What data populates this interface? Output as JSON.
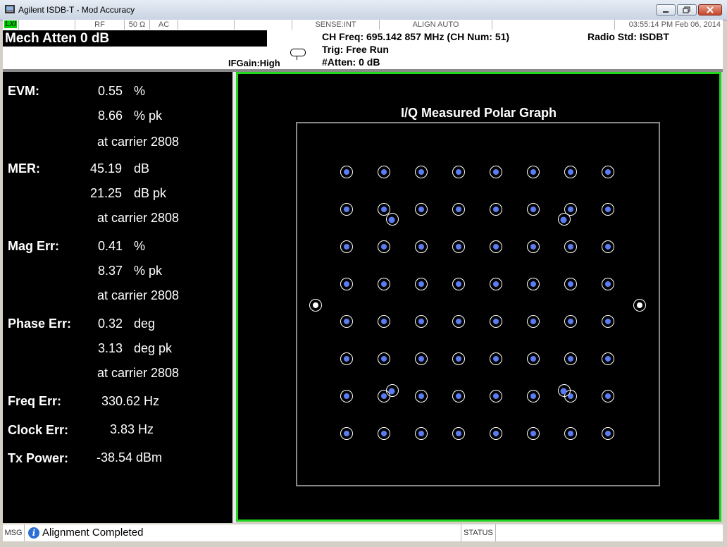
{
  "window": {
    "title": "Agilent ISDB-T - Mod Accuracy",
    "controls": {
      "minimize": "minimize",
      "restore": "restore",
      "close": "close"
    }
  },
  "status_bar": {
    "lxi": "LXI",
    "rf": "RF",
    "impedance": "50 Ω",
    "coupling": "AC",
    "sense": "SENSE:INT",
    "align": "ALIGN AUTO",
    "datetime": "03:55:14 PM Feb 06, 2014"
  },
  "header": {
    "mech_atten": "Mech Atten 0 dB",
    "ch_freq": "CH Freq: 695.142 857 MHz (CH Num: 51)",
    "trig": "Trig: Free Run",
    "atten": "#Atten: 0 dB",
    "ifgain": "IFGain:High",
    "radio_std": "Radio Std: ISDBT"
  },
  "metrics": {
    "evm": {
      "label": "EVM:",
      "rms_value": "0.55",
      "rms_unit": "%",
      "pk_value": "8.66",
      "pk_unit": "% pk",
      "carrier": "at carrier 2808"
    },
    "mer": {
      "label": "MER:",
      "rms_value": "45.19",
      "rms_unit": "dB",
      "pk_value": "21.25",
      "pk_unit": "dB pk",
      "carrier": "at carrier 2808"
    },
    "mag_err": {
      "label": "Mag Err:",
      "rms_value": "0.41",
      "rms_unit": "%",
      "pk_value": "8.37",
      "pk_unit": "% pk",
      "carrier": "at carrier 2808"
    },
    "phase_err": {
      "label": "Phase Err:",
      "rms_value": "0.32",
      "rms_unit": "deg",
      "pk_value": "3.13",
      "pk_unit": "deg pk",
      "carrier": "at carrier 2808"
    },
    "freq_err": {
      "label": "Freq Err:",
      "value": "330.62 Hz"
    },
    "clock_err": {
      "label": "Clock Err:",
      "value": "3.83 Hz"
    },
    "tx_power": {
      "label": "Tx Power:",
      "value": "-38.54 dBm"
    }
  },
  "graph": {
    "title": "I/Q Measured Polar Graph",
    "constellation": "64QAM",
    "colors": {
      "border": "#1fd81f",
      "frame": "#888888",
      "points": "#5b7cf5",
      "rings": "#ffffff"
    }
  },
  "bottom": {
    "msg_label": "MSG",
    "message": "Alignment Completed",
    "status_label": "STATUS"
  }
}
